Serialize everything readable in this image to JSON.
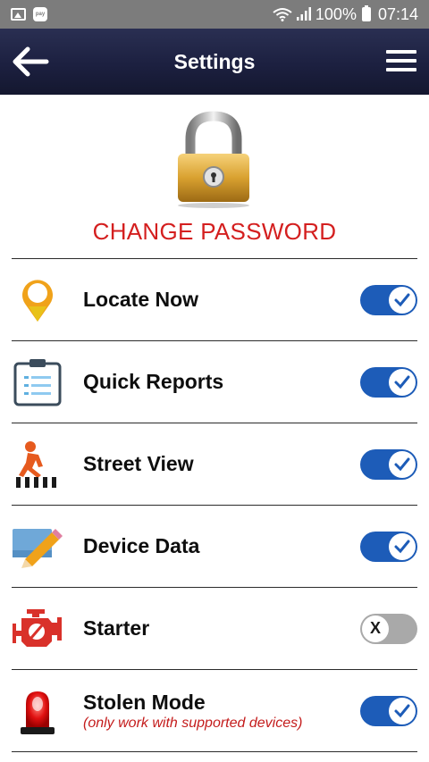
{
  "status_bar": {
    "pay_text": "pay",
    "battery": "100%",
    "time": "07:14"
  },
  "app_bar": {
    "title": "Settings",
    "back_icon": "arrow-left-icon",
    "menu_icon": "hamburger-menu-icon",
    "color": "#1c2040"
  },
  "change_password": {
    "icon": "padlock-icon",
    "label": "CHANGE PASSWORD",
    "color": "#d41f1f"
  },
  "settings": [
    {
      "label": "Locate Now",
      "icon": "map-pin-icon",
      "enabled": true
    },
    {
      "label": "Quick Reports",
      "icon": "clipboard-icon",
      "enabled": true
    },
    {
      "label": "Street View",
      "icon": "pedestrian-crossing-icon",
      "enabled": true
    },
    {
      "label": "Device Data",
      "icon": "pencil-note-icon",
      "enabled": true
    },
    {
      "label": "Starter",
      "icon": "engine-icon",
      "enabled": false,
      "off_glyph": "X"
    },
    {
      "label": "Stolen Mode",
      "sublabel": "(only work with supported devices)",
      "icon": "siren-icon",
      "enabled": true
    }
  ],
  "colors": {
    "toggle_on": "#1d5cb8",
    "toggle_off": "#a9a9a9",
    "accent_red": "#d41f1f"
  }
}
